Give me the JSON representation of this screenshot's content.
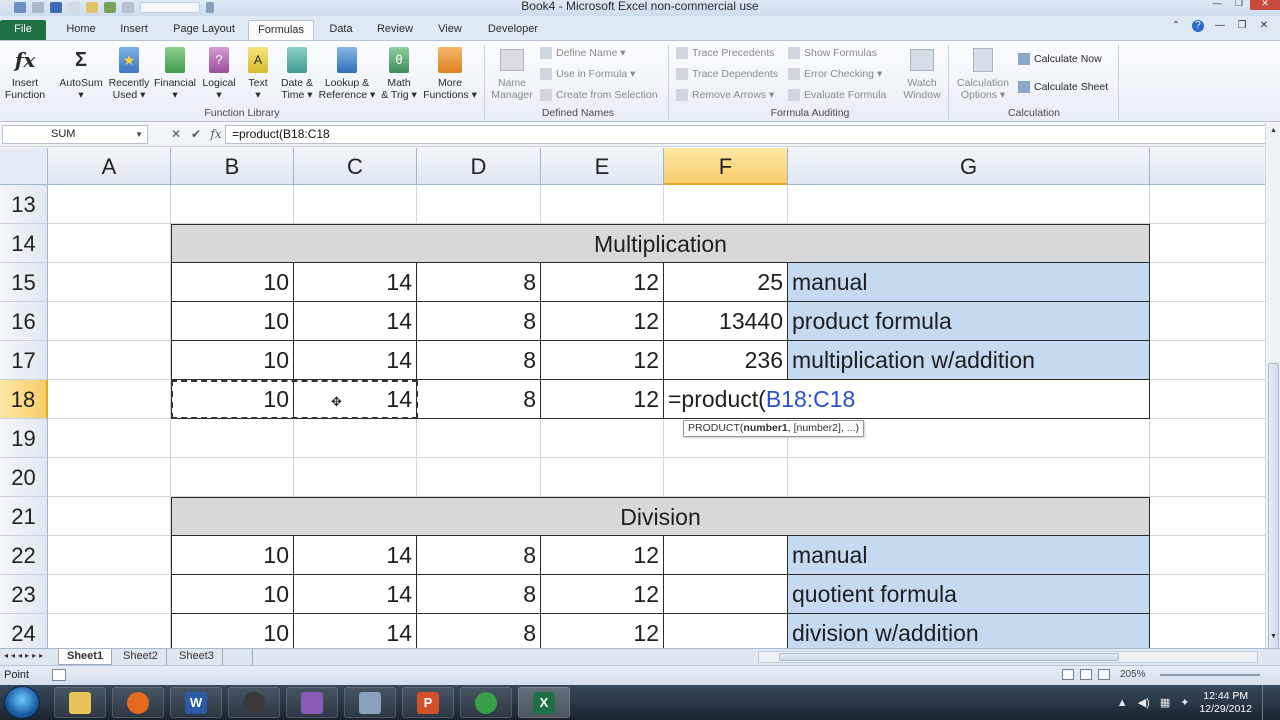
{
  "window": {
    "title": "Book4  -  Microsoft Excel non-commercial use"
  },
  "tabs": [
    "File",
    "Home",
    "Insert",
    "Page Layout",
    "Formulas",
    "Data",
    "Review",
    "View",
    "Developer"
  ],
  "active_tab": "Formulas",
  "ribbon": {
    "function_library": {
      "label": "Function Library",
      "buttons": [
        {
          "line1": "Insert",
          "line2": "Function",
          "icon": "fx-icon"
        },
        {
          "line1": "AutoSum",
          "line2": "▾",
          "icon": "sigma-icon"
        },
        {
          "line1": "Recently",
          "line2": "Used ▾",
          "icon": "star-book-icon"
        },
        {
          "line1": "Financial",
          "line2": "▾",
          "icon": "book-icon"
        },
        {
          "line1": "Logical",
          "line2": "▾",
          "icon": "question-book-icon"
        },
        {
          "line1": "Text",
          "line2": "▾",
          "icon": "text-book-icon"
        },
        {
          "line1": "Date &",
          "line2": "Time ▾",
          "icon": "clock-book-icon"
        },
        {
          "line1": "Lookup &",
          "line2": "Reference ▾",
          "icon": "magnifier-book-icon"
        },
        {
          "line1": "Math",
          "line2": "& Trig ▾",
          "icon": "theta-book-icon"
        },
        {
          "line1": "More",
          "line2": "Functions ▾",
          "icon": "books-icon"
        }
      ]
    },
    "defined_names": {
      "label": "Defined Names",
      "name_manager": {
        "line1": "Name",
        "line2": "Manager"
      },
      "items": [
        "Define Name ▾",
        "Use in Formula ▾",
        "Create from Selection"
      ]
    },
    "formula_auditing": {
      "label": "Formula Auditing",
      "left_items": [
        "Trace Precedents",
        "Trace Dependents",
        "Remove Arrows ▾"
      ],
      "right_items": [
        "Show Formulas",
        "Error Checking ▾",
        "Evaluate Formula"
      ],
      "watch": {
        "line1": "Watch",
        "line2": "Window"
      }
    },
    "calculation": {
      "label": "Calculation",
      "options": {
        "line1": "Calculation",
        "line2": "Options ▾"
      },
      "items": [
        "Calculate Now",
        "Calculate Sheet"
      ]
    }
  },
  "formula_bar": {
    "name_box": "SUM",
    "cancel": "✕",
    "enter": "✔",
    "fx": "fx",
    "formula": "=product(B18:C18"
  },
  "columns": [
    "A",
    "B",
    "C",
    "D",
    "E",
    "F",
    "G"
  ],
  "selected_column": "F",
  "rows": [
    "13",
    "14",
    "15",
    "16",
    "17",
    "18",
    "19",
    "20",
    "21",
    "22",
    "23",
    "24"
  ],
  "selected_row": "18",
  "sheet": {
    "multiplication_header": "Multiplication",
    "mult_rows": [
      {
        "b": "10",
        "c": "14",
        "d": "8",
        "e": "12",
        "f": "25",
        "g": "manual"
      },
      {
        "b": "10",
        "c": "14",
        "d": "8",
        "e": "12",
        "f": "13440",
        "g": "product formula"
      },
      {
        "b": "10",
        "c": "14",
        "d": "8",
        "e": "12",
        "f": "236",
        "g": "multiplication w/addition"
      },
      {
        "b": "10",
        "c": "14",
        "d": "8",
        "e": "12"
      }
    ],
    "editing_formula_prefix": "=product(",
    "editing_formula_ref": "B18:C18",
    "tooltip_prefix": "PRODUCT(",
    "tooltip_bold": "number1",
    "tooltip_rest": ", [number2], ...)",
    "division_header": "Division",
    "div_rows": [
      {
        "b": "10",
        "c": "14",
        "d": "8",
        "e": "12",
        "g": "manual"
      },
      {
        "b": "10",
        "c": "14",
        "d": "8",
        "e": "12",
        "g": "quotient formula"
      },
      {
        "b": "10",
        "c": "14",
        "d": "8",
        "e": "12",
        "g": "division w/addition"
      }
    ]
  },
  "sheet_tabs": [
    "Sheet1",
    "Sheet2",
    "Sheet3"
  ],
  "active_sheet": "Sheet1",
  "status": {
    "mode": "Point",
    "zoom": "205%"
  },
  "taskbar": {
    "time": "12:44 PM",
    "date": "12/29/2012"
  },
  "colors": {
    "file_tab": "#1e7145",
    "blue_cell": "#c5d9f1",
    "gray_header": "#d8d8d8",
    "selected_header": "#f8cd6a",
    "formula_ref": "#2a4fd0"
  }
}
